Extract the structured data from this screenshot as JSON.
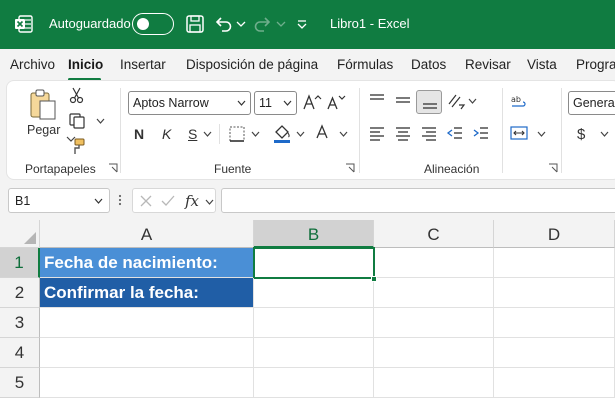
{
  "titlebar": {
    "app_icon": "excel-icon",
    "autosave_label": "Autoguardado",
    "autosave_on": false,
    "doc_title": "Libro1  -  Excel",
    "bg_color": "#107c41"
  },
  "tabs": [
    {
      "label": "Archivo",
      "active": false
    },
    {
      "label": "Inicio",
      "active": true
    },
    {
      "label": "Insertar",
      "active": false
    },
    {
      "label": "Disposición de página",
      "active": false
    },
    {
      "label": "Fórmulas",
      "active": false
    },
    {
      "label": "Datos",
      "active": false
    },
    {
      "label": "Revisar",
      "active": false
    },
    {
      "label": "Vista",
      "active": false
    },
    {
      "label": "Progra",
      "active": false
    }
  ],
  "ribbon": {
    "clipboard": {
      "paste_label": "Pegar",
      "group_label": "Portapapeles"
    },
    "font": {
      "font_name": "Aptos Narrow",
      "font_size": "11",
      "bold_label": "N",
      "italic_label": "K",
      "underline_label": "S",
      "group_label": "Fuente"
    },
    "alignment": {
      "group_label": "Alineación"
    },
    "number": {
      "format": "General",
      "currency_symbol": "$"
    }
  },
  "formula_bar": {
    "name_box": "B1",
    "fx_label": "fx",
    "formula": ""
  },
  "grid": {
    "columns": [
      "A",
      "B",
      "C",
      "D"
    ],
    "selected_column": "B",
    "rows": [
      "1",
      "2",
      "3",
      "4",
      "5"
    ],
    "selected_row": "1",
    "cells": {
      "A1": "Fecha de nacimiento:",
      "A2": "Confirmar la fecha:"
    },
    "active_cell": "B1",
    "colors": {
      "a1_fill": "#4a8fd6",
      "a2_fill": "#205ea6",
      "accent": "#107c41"
    }
  }
}
